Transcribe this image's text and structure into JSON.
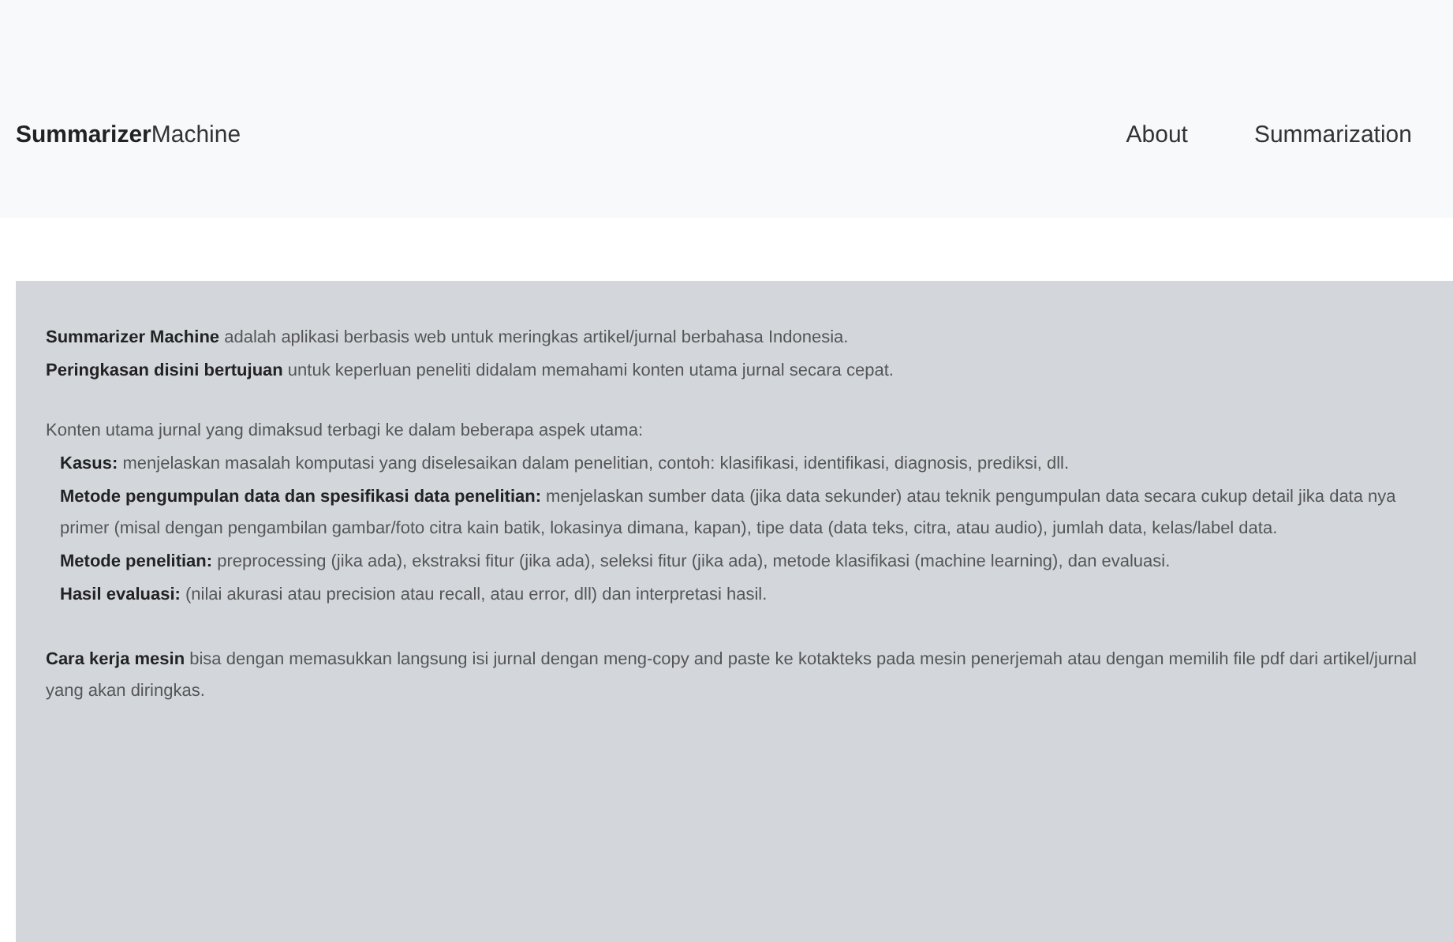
{
  "navbar": {
    "brand": "**Summarizer**Machine",
    "links": [
      {
        "label": "About"
      },
      {
        "label": "Summarization"
      }
    ]
  },
  "content": {
    "intro": [
      "**Summarizer Machine** adalah aplikasi berbasis web untuk meringkas artikel/jurnal berbahasa Indonesia.",
      "**Peringkasan disini bertujuan** untuk keperluan peneliti didalam memahami konten utama jurnal secara cepat."
    ],
    "aspects_heading": "Konten utama jurnal yang dimaksud terbagi ke dalam beberapa aspek utama:",
    "aspects": [
      "**Kasus:** menjelaskan masalah komputasi yang diselesaikan dalam penelitian, contoh: klasifikasi, identifikasi, diagnosis, prediksi, dll.",
      "**Metode pengumpulan data dan spesifikasi data penelitian:** menjelaskan sumber data (jika data sekunder) atau teknik pengumpulan data secara cukup detail jika data nya primer (misal dengan pengambilan gambar/foto citra kain batik, lokasinya dimana, kapan), tipe data (data teks, citra, atau audio), jumlah data, kelas/label data.",
      "**Metode penelitian:** preprocessing (jika ada), ekstraksi fitur (jika ada), seleksi fitur (jika ada), metode klasifikasi (machine learning), dan evaluasi.",
      "**Hasil evaluasi:** (nilai akurasi atau precision atau recall, atau error, dll) dan interpretasi hasil."
    ],
    "closing": "**Cara kerja mesin** bisa dengan memasukkan langsung isi jurnal dengan meng-copy and paste ke kotakteks pada mesin penerjemah atau dengan memilih file pdf dari artikel/jurnal yang akan diringkas."
  }
}
